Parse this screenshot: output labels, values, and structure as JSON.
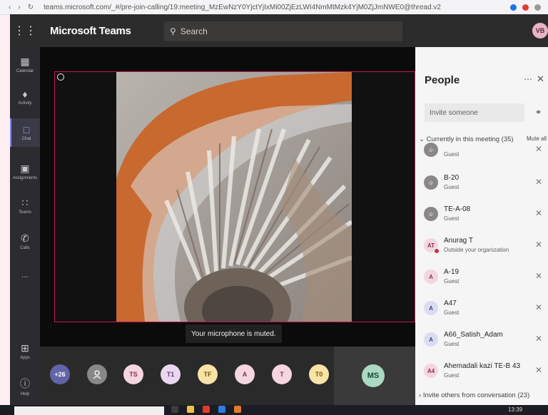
{
  "browser": {
    "url": "teams.microsoft.com/_#/pre-join-calling/19:meeting_MzEwNzY0YjctYjIxMi00ZjEzLWI4NmMtMzk4YjM0ZjJmNWE0@thread.v2"
  },
  "app": {
    "title": "Microsoft Teams",
    "search_placeholder": "Search",
    "user_initials": "VB"
  },
  "rail": [
    {
      "label": "Calendar",
      "icon": "calendar-icon"
    },
    {
      "label": "Activity",
      "icon": "bell-icon"
    },
    {
      "label": "Chat",
      "icon": "chat-icon",
      "active": true
    },
    {
      "label": "Assignments",
      "icon": "assignments-icon"
    },
    {
      "label": "Teams",
      "icon": "teams-icon"
    },
    {
      "label": "Calls",
      "icon": "phone-icon"
    },
    {
      "label": "...",
      "icon": "more-icon"
    },
    {
      "label": "Apps",
      "icon": "apps-icon"
    },
    {
      "label": "Help",
      "icon": "help-icon"
    }
  ],
  "stage": {
    "toast": "Your microphone is muted."
  },
  "tray": {
    "overflow": "+26",
    "participants": [
      "TS",
      "T1",
      "TF",
      "A",
      "T",
      "T0"
    ],
    "self_initials": "MS"
  },
  "people": {
    "title": "People",
    "invite_placeholder": "Invite someone",
    "section_label": "Currently in this meeting (35)",
    "mute_all": "Mute all",
    "list": [
      {
        "name": "",
        "role": "Guest",
        "initials": "",
        "style": "guest"
      },
      {
        "name": "B-20",
        "role": "Guest",
        "initials": "",
        "style": "guest"
      },
      {
        "name": "TE-A-08",
        "role": "Guest",
        "initials": "",
        "style": "guest"
      },
      {
        "name": "Anurag T",
        "role": "Outside your organization",
        "initials": "AT",
        "style": "pink"
      },
      {
        "name": "A-19",
        "role": "Guest",
        "initials": "A",
        "style": "pink"
      },
      {
        "name": "A47",
        "role": "Guest",
        "initials": "A",
        "style": "lav"
      },
      {
        "name": "A66_Satish_Adam",
        "role": "Guest",
        "initials": "A",
        "style": "lav"
      },
      {
        "name": "Ahemadali kazi TE-B 43",
        "role": "Guest",
        "initials": "A4",
        "style": "pink"
      }
    ],
    "invite_conversation": "Invite others from conversation (23)"
  },
  "taskbar": {
    "time": "13:39"
  },
  "colors": {
    "accent": "#7f85f5",
    "focus_border": "#c2185b",
    "presence_busy": "#c4314b"
  }
}
